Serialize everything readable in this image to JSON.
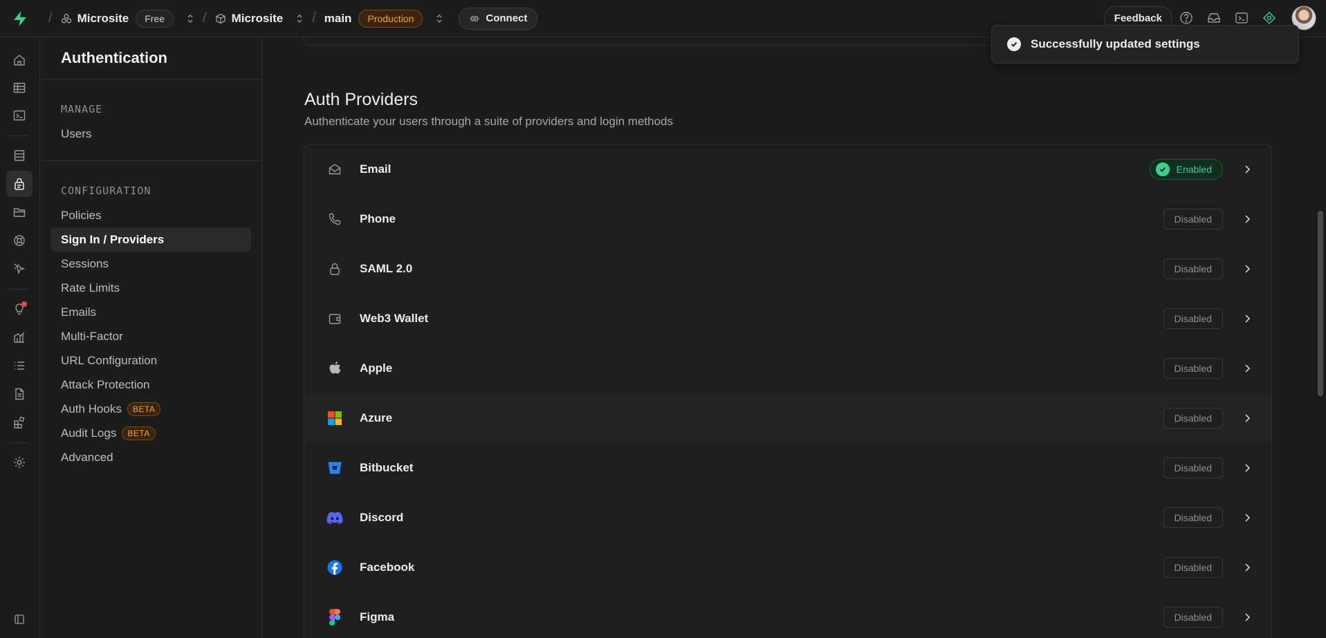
{
  "topbar": {
    "org_name": "Microsite",
    "org_plan": "Free",
    "project_name": "Microsite",
    "branch": "main",
    "env_badge": "Production",
    "connect_label": "Connect",
    "feedback_label": "Feedback"
  },
  "sidebar": {
    "title": "Authentication",
    "manage_label": "MANAGE",
    "manage_items": [
      {
        "label": "Users"
      }
    ],
    "config_label": "CONFIGURATION",
    "config_items": [
      {
        "label": "Policies"
      },
      {
        "label": "Sign In / Providers"
      },
      {
        "label": "Sessions"
      },
      {
        "label": "Rate Limits"
      },
      {
        "label": "Emails"
      },
      {
        "label": "Multi-Factor"
      },
      {
        "label": "URL Configuration"
      },
      {
        "label": "Attack Protection"
      },
      {
        "label": "Auth Hooks",
        "badge": "BETA"
      },
      {
        "label": "Audit Logs",
        "badge": "BETA"
      },
      {
        "label": "Advanced"
      }
    ]
  },
  "main": {
    "heading": "Auth Providers",
    "subheading": "Authenticate your users through a suite of providers and login methods",
    "providers": [
      {
        "name": "Email",
        "status": "Enabled",
        "icon": "mail-icon"
      },
      {
        "name": "Phone",
        "status": "Disabled",
        "icon": "phone-icon"
      },
      {
        "name": "SAML 2.0",
        "status": "Disabled",
        "icon": "lock-icon"
      },
      {
        "name": "Web3 Wallet",
        "status": "Disabled",
        "icon": "wallet-icon"
      },
      {
        "name": "Apple",
        "status": "Disabled",
        "icon": "apple-icon"
      },
      {
        "name": "Azure",
        "status": "Disabled",
        "icon": "azure-icon"
      },
      {
        "name": "Bitbucket",
        "status": "Disabled",
        "icon": "bitbucket-icon"
      },
      {
        "name": "Discord",
        "status": "Disabled",
        "icon": "discord-icon"
      },
      {
        "name": "Facebook",
        "status": "Disabled",
        "icon": "facebook-icon"
      },
      {
        "name": "Figma",
        "status": "Disabled",
        "icon": "figma-icon"
      }
    ]
  },
  "toast": {
    "message": "Successfully updated settings"
  },
  "colors": {
    "background": "#1c1c1c",
    "accent_green": "#3ecf8e",
    "badge_orange": "#f5a524"
  }
}
